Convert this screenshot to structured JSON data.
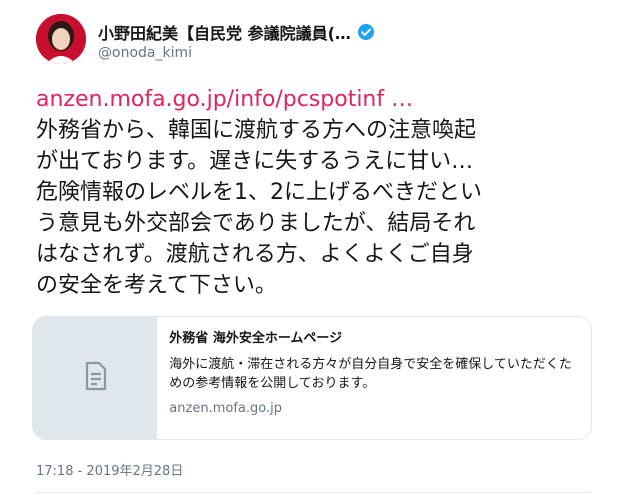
{
  "user": {
    "display_name": "小野田紀美【自民党 参議院議員(…",
    "handle": "@onoda_kimi",
    "verified_icon": "verified-badge-icon"
  },
  "tweet": {
    "link": "anzen.mofa.go.jp/info/pcspotinf …",
    "lines": [
      "外務省から、韓国に渡航する方への注意喚起",
      "が出ております。遅きに失するうえに甘い…",
      "危険情報のレベルを1、2に上げるべきだとい",
      "う意見も外交部会でありましたが、結局それ",
      "はなされず。渡航される方、よくよくご自身",
      "の安全を考えて下さい。"
    ],
    "timestamp": "17:18 - 2019年2月28日"
  },
  "card": {
    "title": "外務省 海外安全ホームページ",
    "description": "海外に渡航・滞在される方々が自分自身で安全を確保していただくための参考情報を公開しております。",
    "domain": "anzen.mofa.go.jp",
    "media_icon": "document-icon"
  },
  "colors": {
    "link": "#e0245e",
    "verified": "#1da1f2",
    "secondary_text": "#657786"
  }
}
